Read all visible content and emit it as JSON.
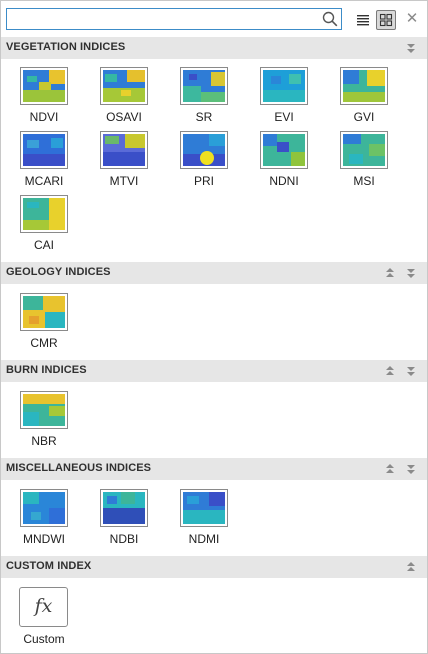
{
  "search": {
    "value": "",
    "placeholder": ""
  },
  "toolbar": {
    "list_view_icon": "list-view-icon",
    "grid_view_icon": "grid-view-icon",
    "close_glyph": "✕"
  },
  "sections": [
    {
      "title": "VEGETATION INDICES",
      "items": [
        "NDVI",
        "OSAVI",
        "SR",
        "EVI",
        "GVI",
        "MCARI",
        "MTVI",
        "PRI",
        "NDNI",
        "MSI",
        "CAI"
      ]
    },
    {
      "title": "GEOLOGY INDICES",
      "items": [
        "CMR"
      ]
    },
    {
      "title": "BURN INDICES",
      "items": [
        "NBR"
      ]
    },
    {
      "title": "MISCELLANEOUS INDICES",
      "items": [
        "MNDWI",
        "NDBI",
        "NDMI"
      ]
    },
    {
      "title": "CUSTOM INDEX",
      "items": [
        "Custom"
      ]
    }
  ],
  "custom": {
    "glyph": "fx"
  },
  "colors": {
    "accent": "#3c8cc8",
    "header_bg": "#e6e6e6",
    "icon_gray": "#8a8a8a"
  }
}
